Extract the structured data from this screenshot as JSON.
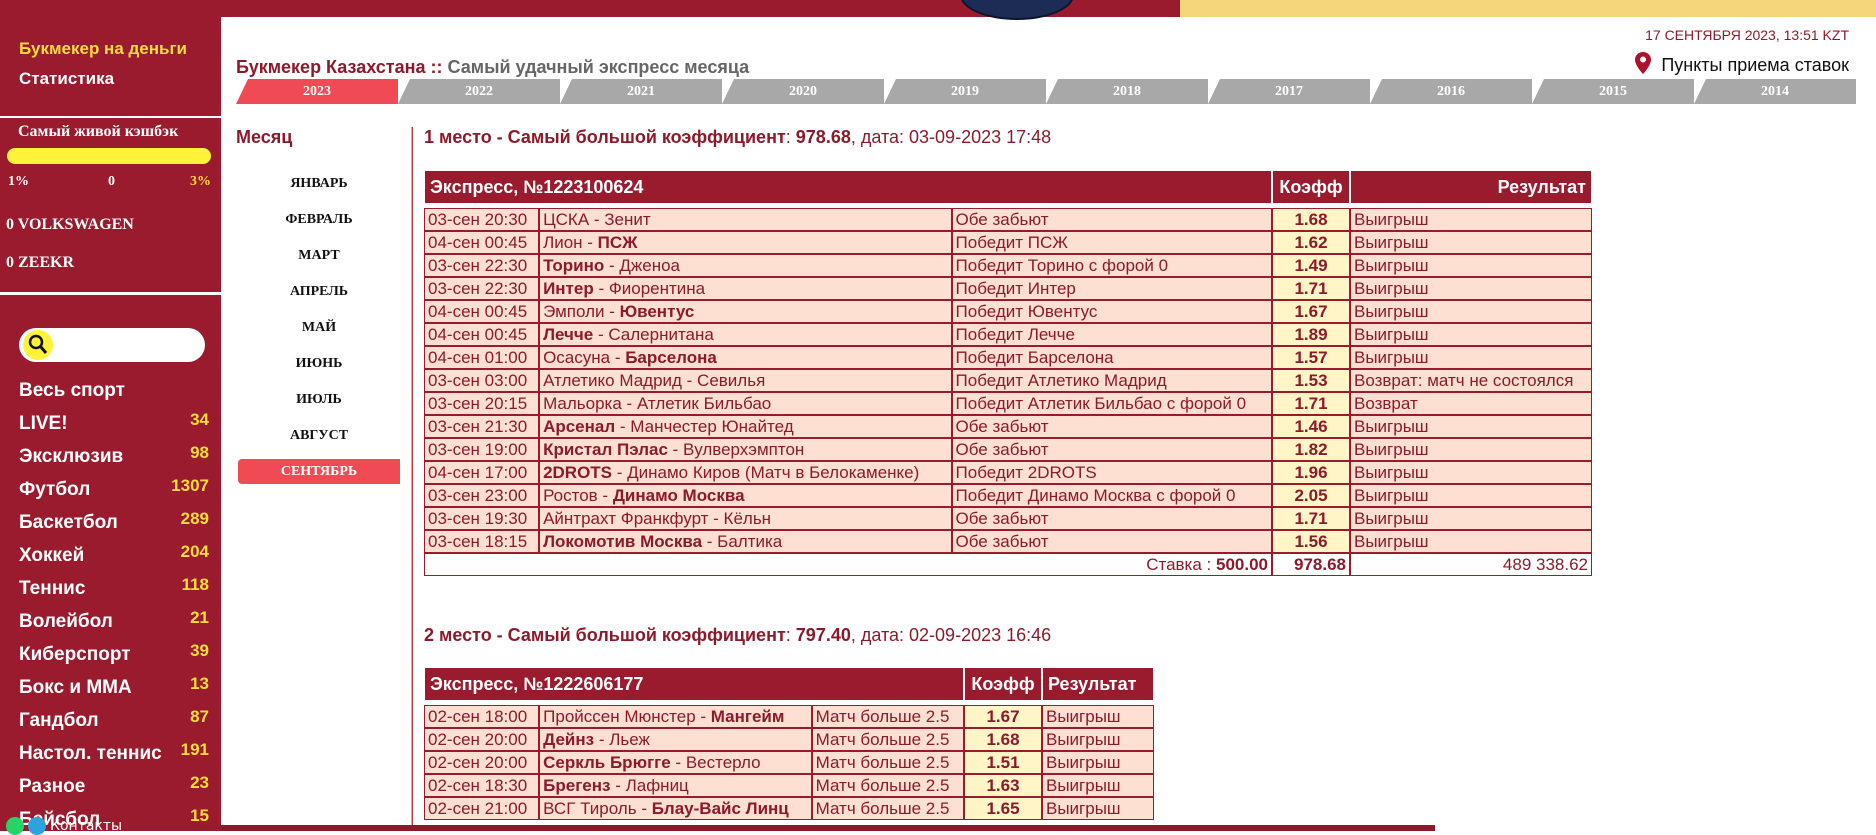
{
  "sidebar": {
    "bookmaker_link": "Букмекер на деньги",
    "stats_link": "Статистика",
    "cashback": {
      "title": "Самый живой кэшбэк",
      "min": "1%",
      "mid": "0",
      "max": "3%",
      "level_percent": 100
    },
    "promos": [
      "0 VOLKSWAGEN",
      "0 ZEEKR"
    ],
    "sports": [
      {
        "label": "Весь спорт",
        "count": ""
      },
      {
        "label": "LIVE!",
        "count": "34"
      },
      {
        "label": "Эксклюзив",
        "count": "98"
      },
      {
        "label": "Футбол",
        "count": "1307"
      },
      {
        "label": "Баскетбол",
        "count": "289"
      },
      {
        "label": "Хоккей",
        "count": "204"
      },
      {
        "label": "Теннис",
        "count": "118"
      },
      {
        "label": "Волейбол",
        "count": "21"
      },
      {
        "label": "Киберспорт",
        "count": "39"
      },
      {
        "label": "Бокс и ММА",
        "count": "13"
      },
      {
        "label": "Гандбол",
        "count": "87"
      },
      {
        "label": "Настол. теннис",
        "count": "191"
      },
      {
        "label": "Разное",
        "count": "23"
      },
      {
        "label": "Бейсбол",
        "count": "15"
      }
    ],
    "contacts": "Контакты"
  },
  "header": {
    "title_part1": "Букмекер Казахстана",
    "separator": "::",
    "title_part2": "Самый удачный экспресс месяца",
    "datetime": "17 СЕНТЯБРЯ 2023, 13:51 KZT",
    "points_link": "Пункты приема ставок"
  },
  "years": [
    "2023",
    "2022",
    "2021",
    "2020",
    "2019",
    "2018",
    "2017",
    "2016",
    "2015",
    "2014"
  ],
  "months_title": "Месяц",
  "months": [
    "ЯНВАРЬ",
    "ФЕВРАЛЬ",
    "МАРТ",
    "АПРЕЛЬ",
    "МАЙ",
    "ИЮНЬ",
    "ИЮЛЬ",
    "АВГУСТ",
    "СЕНТЯБРЬ"
  ],
  "places": [
    {
      "heading": "1 место - Самый большой коэффициент",
      "coef": "978.68",
      "date_label": ", дата: ",
      "date": "03-09-2023 17:48",
      "express_label": "Экспресс, №1223100624",
      "col_coef": "Коэфф",
      "col_result": "Результат",
      "rows": [
        {
          "time": "03-сен 20:30",
          "home": "ЦСКА",
          "away": "Зенит",
          "bold": "",
          "bet": "Обе забьют",
          "k": "1.68",
          "res": "Выигрыш"
        },
        {
          "time": "04-сен 00:45",
          "home": "Лион",
          "away": "ПСЖ",
          "bold": "away",
          "bet": "Победит ПСЖ",
          "k": "1.62",
          "res": "Выигрыш"
        },
        {
          "time": "03-сен 22:30",
          "home": "Торино",
          "away": "Дженоа",
          "bold": "home",
          "bet": "Победит Торино с форой 0",
          "k": "1.49",
          "res": "Выигрыш"
        },
        {
          "time": "03-сен 22:30",
          "home": "Интер",
          "away": "Фиорентина",
          "bold": "home",
          "bet": "Победит Интер",
          "k": "1.71",
          "res": "Выигрыш"
        },
        {
          "time": "04-сен 00:45",
          "home": "Эмполи",
          "away": "Ювентус",
          "bold": "away",
          "bet": "Победит Ювентус",
          "k": "1.67",
          "res": "Выигрыш"
        },
        {
          "time": "04-сен 00:45",
          "home": "Лечче",
          "away": "Салернитана",
          "bold": "home",
          "bet": "Победит Лечче",
          "k": "1.89",
          "res": "Выигрыш"
        },
        {
          "time": "04-сен 01:00",
          "home": "Осасуна",
          "away": "Барселона",
          "bold": "away",
          "bet": "Победит Барселона",
          "k": "1.57",
          "res": "Выигрыш"
        },
        {
          "time": "03-сен 03:00",
          "home": "Атлетико Мадрид",
          "away": "Севилья",
          "bold": "",
          "bet": "Победит Атлетико Мадрид",
          "k": "1.53",
          "res": "Возврат: матч не состоялся"
        },
        {
          "time": "03-сен 20:15",
          "home": "Мальорка",
          "away": "Атлетик Бильбао",
          "bold": "",
          "bet": "Победит Атлетик Бильбао с форой 0",
          "k": "1.71",
          "res": "Возврат"
        },
        {
          "time": "03-сен 21:30",
          "home": "Арсенал",
          "away": "Манчестер Юнайтед",
          "bold": "home",
          "bet": "Обе забьют",
          "k": "1.46",
          "res": "Выигрыш"
        },
        {
          "time": "03-сен 19:00",
          "home": "Кристал Пэлас",
          "away": "Вулверхэмптон",
          "bold": "home",
          "bet": "Обе забьют",
          "k": "1.82",
          "res": "Выигрыш"
        },
        {
          "time": "04-сен 17:00",
          "home": "2DROTS",
          "away": "Динамо Киров (Матч в Белокаменке)",
          "bold": "home",
          "bet": "Победит 2DROTS",
          "k": "1.96",
          "res": "Выигрыш"
        },
        {
          "time": "03-сен 23:00",
          "home": "Ростов",
          "away": "Динамо Москва",
          "bold": "away",
          "bet": "Победит Динамо Москва с форой 0",
          "k": "2.05",
          "res": "Выигрыш"
        },
        {
          "time": "03-сен 19:30",
          "home": "Айнтрахт Франкфурт",
          "away": "Кёльн",
          "bold": "",
          "bet": "Обе забьют",
          "k": "1.71",
          "res": "Выигрыш"
        },
        {
          "time": "03-сен 18:15",
          "home": "Локомотив Москва",
          "away": "Балтика",
          "bold": "home",
          "bet": "Обе забьют",
          "k": "1.56",
          "res": "Выигрыш"
        }
      ],
      "stake_label": "Ставка : ",
      "stake": "500.00",
      "total_coef": "978.68",
      "payout": "489 338.62"
    },
    {
      "heading": "2 место - Самый большой коэффициент",
      "coef": "797.40",
      "date_label": ", дата: ",
      "date": "02-09-2023 16:46",
      "express_label": "Экспресс, №1222606177",
      "col_coef": "Коэфф",
      "col_result": "Результат",
      "rows": [
        {
          "time": "02-сен 18:00",
          "home": "Пройссен Мюнстер",
          "away": "Мангейм",
          "bold": "away",
          "bet": "Матч больше 2.5",
          "k": "1.67",
          "res": "Выигрыш"
        },
        {
          "time": "02-сен 20:00",
          "home": "Дейнз",
          "away": "Льеж",
          "bold": "home",
          "bet": "Матч больше 2.5",
          "k": "1.68",
          "res": "Выигрыш"
        },
        {
          "time": "02-сен 20:00",
          "home": "Серкль Брюгге",
          "away": "Вестерло",
          "bold": "home",
          "bet": "Матч больше 2.5",
          "k": "1.51",
          "res": "Выигрыш"
        },
        {
          "time": "02-сен 18:30",
          "home": "Брегенз",
          "away": "Лафниц",
          "bold": "home",
          "bet": "Матч больше 2.5",
          "k": "1.63",
          "res": "Выигрыш"
        },
        {
          "time": "02-сен 21:00",
          "home": "ВСГ Тироль",
          "away": "Блау-Вайс Линц",
          "bold": "away",
          "bet": "Матч больше 2.5",
          "k": "1.65",
          "res": "Выигрыш"
        }
      ]
    }
  ]
}
